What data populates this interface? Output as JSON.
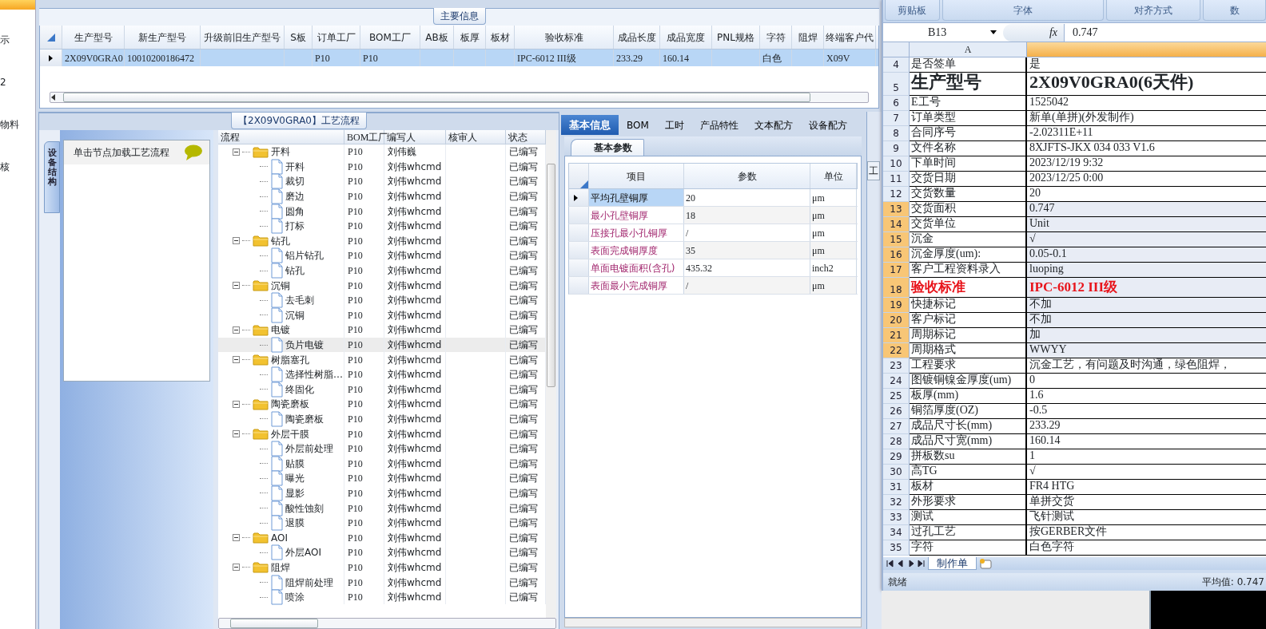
{
  "sidebar": {
    "items": [
      {
        "selected": true
      },
      {
        "label": "示",
        "selected": false
      },
      {
        "label": "2",
        "selected": false
      },
      {
        "label": "物料",
        "selected": false
      },
      {
        "label": "核",
        "selected": false
      }
    ]
  },
  "main_info": {
    "title": "主要信息",
    "columns": [
      "生产型号",
      "新生产型号",
      "升级前旧生产型号",
      "S板",
      "订单工厂",
      "BOM工厂",
      "AB板",
      "板厚",
      "板材",
      "验收标准",
      "成品长度",
      "成品宽度",
      "PNL规格",
      "字符",
      "阻焊",
      "终端客户代"
    ],
    "rows": [
      {
        "selected": true,
        "cells": [
          "2X09V0GRA0",
          "10010200186472",
          null,
          null,
          "P10",
          "P10",
          null,
          null,
          null,
          "IPC-6012 III级",
          "233.29",
          "160.14",
          null,
          "白色",
          null,
          "X09V"
        ]
      }
    ]
  },
  "process": {
    "title": "【2X09V0GRA0】工艺流程",
    "side_tab": "设备结构",
    "hint": "单击节点加载工艺流程",
    "columns": [
      "流程",
      "BOM工厂",
      "编写人",
      "核审人",
      "状态"
    ],
    "tree": [
      {
        "label": "开料",
        "bom": "P10",
        "author": "刘伟巍",
        "status": "已编写",
        "expanded": true,
        "selected": false,
        "children": [
          {
            "label": "开料",
            "bom": "P10",
            "author": "刘伟whcmd",
            "status": "已编写",
            "selected": false
          },
          {
            "label": "裁切",
            "bom": "P10",
            "author": "刘伟whcmd",
            "status": "已编写",
            "selected": false
          },
          {
            "label": "磨边",
            "bom": "P10",
            "author": "刘伟whcmd",
            "status": "已编写",
            "selected": false
          },
          {
            "label": "圆角",
            "bom": "P10",
            "author": "刘伟whcmd",
            "status": "已编写",
            "selected": false
          },
          {
            "label": "打标",
            "bom": "P10",
            "author": "刘伟whcmd",
            "status": "已编写",
            "selected": false
          }
        ]
      },
      {
        "label": "钻孔",
        "bom": "P10",
        "author": "刘伟whcmd",
        "status": "已编写",
        "expanded": true,
        "selected": false,
        "children": [
          {
            "label": "铝片钻孔",
            "bom": "P10",
            "author": "刘伟whcmd",
            "status": "已编写",
            "selected": false
          },
          {
            "label": "钻孔",
            "bom": "P10",
            "author": "刘伟whcmd",
            "status": "已编写",
            "selected": false
          }
        ]
      },
      {
        "label": "沉铜",
        "bom": "P10",
        "author": "刘伟whcmd",
        "status": "已编写",
        "expanded": true,
        "selected": false,
        "children": [
          {
            "label": "去毛刺",
            "bom": "P10",
            "author": "刘伟whcmd",
            "status": "已编写",
            "selected": false
          },
          {
            "label": "沉铜",
            "bom": "P10",
            "author": "刘伟whcmd",
            "status": "已编写",
            "selected": false
          }
        ]
      },
      {
        "label": "电镀",
        "bom": "P10",
        "author": "刘伟whcmd",
        "status": "已编写",
        "expanded": true,
        "selected": false,
        "children": [
          {
            "label": "负片电镀",
            "bom": "P10",
            "author": "刘伟whcmd",
            "status": "已编写",
            "selected": true
          }
        ]
      },
      {
        "label": "树脂塞孔",
        "bom": "P10",
        "author": "刘伟whcmd",
        "status": "已编写",
        "expanded": true,
        "selected": false,
        "children": [
          {
            "label": "选择性树脂…",
            "bom": "P10",
            "author": "刘伟whcmd",
            "status": "已编写",
            "selected": false
          },
          {
            "label": "终固化",
            "bom": "P10",
            "author": "刘伟whcmd",
            "status": "已编写",
            "selected": false
          }
        ]
      },
      {
        "label": "陶瓷磨板",
        "bom": "P10",
        "author": "刘伟whcmd",
        "status": "已编写",
        "expanded": true,
        "selected": false,
        "children": [
          {
            "label": "陶瓷磨板",
            "bom": "P10",
            "author": "刘伟whcmd",
            "status": "已编写",
            "selected": false
          }
        ]
      },
      {
        "label": "外层干膜",
        "bom": "P10",
        "author": "刘伟whcmd",
        "status": "已编写",
        "expanded": true,
        "selected": false,
        "children": [
          {
            "label": "外层前处理",
            "bom": "P10",
            "author": "刘伟whcmd",
            "status": "已编写",
            "selected": false
          },
          {
            "label": "贴膜",
            "bom": "P10",
            "author": "刘伟whcmd",
            "status": "已编写",
            "selected": false
          },
          {
            "label": "曝光",
            "bom": "P10",
            "author": "刘伟whcmd",
            "status": "已编写",
            "selected": false
          },
          {
            "label": "显影",
            "bom": "P10",
            "author": "刘伟whcmd",
            "status": "已编写",
            "selected": false
          },
          {
            "label": "酸性蚀刻",
            "bom": "P10",
            "author": "刘伟whcmd",
            "status": "已编写",
            "selected": false
          },
          {
            "label": "退膜",
            "bom": "P10",
            "author": "刘伟whcmd",
            "status": "已编写",
            "selected": false
          }
        ]
      },
      {
        "label": "AOI",
        "bom": "P10",
        "author": "刘伟whcmd",
        "status": "已编写",
        "expanded": true,
        "selected": false,
        "children": [
          {
            "label": "外层AOI",
            "bom": "P10",
            "author": "刘伟whcmd",
            "status": "已编写",
            "selected": false
          }
        ]
      },
      {
        "label": "阻焊",
        "bom": "P10",
        "author": "刘伟whcmd",
        "status": "已编写",
        "expanded": true,
        "selected": false,
        "children": [
          {
            "label": "阻焊前处理",
            "bom": "P10",
            "author": "刘伟whcmd",
            "status": "已编写",
            "selected": false
          },
          {
            "label": "喷涂",
            "bom": "P10",
            "author": "刘伟whcmd",
            "status": "已编写",
            "selected": false
          }
        ]
      }
    ]
  },
  "detail": {
    "tabs": [
      {
        "label": "基本信息",
        "selected": true
      },
      {
        "label": "BOM",
        "selected": false
      },
      {
        "label": "工时",
        "selected": false
      },
      {
        "label": "产品特性",
        "selected": false
      },
      {
        "label": "文本配方",
        "selected": false
      },
      {
        "label": "设备配方",
        "selected": false
      }
    ],
    "subtab": "基本参数",
    "columns": [
      "项目",
      "参数",
      "单位"
    ],
    "rows": [
      {
        "item": "平均孔壁铜厚",
        "value": "20",
        "unit": "μm",
        "selected": true
      },
      {
        "item": "最小孔壁铜厚",
        "value": "18",
        "unit": "μm",
        "selected": false
      },
      {
        "item": "压接孔最小孔铜厚",
        "value": "/",
        "unit": "μm",
        "selected": false
      },
      {
        "item": "表面完成铜厚度",
        "value": "35",
        "unit": "μm",
        "selected": false
      },
      {
        "item": "单面电镀面积(含孔)",
        "value": "435.32",
        "unit": "inch2",
        "selected": false
      },
      {
        "item": "表面最小完成铜厚",
        "value": "/",
        "unit": "μm",
        "selected": false
      }
    ]
  },
  "side_panel": {
    "label": "工"
  },
  "excel": {
    "ribbon_groups": [
      "剪贴板",
      "字体",
      "对齐方式",
      "数"
    ],
    "name_box": "B13",
    "function_symbol": "fx",
    "formula": "0.747",
    "column_a": "A",
    "rows": [
      {
        "n": "4",
        "a": "是否签单",
        "b": "是",
        "kind": "normal",
        "selected": false
      },
      {
        "n": "5",
        "a": "生产型号",
        "b": "2X09V0GRA0(6天件)",
        "kind": "title",
        "selected": false
      },
      {
        "n": "6",
        "a": "E工号",
        "b": "1525042",
        "kind": "normal",
        "selected": false
      },
      {
        "n": "7",
        "a": "订单类型",
        "b": "新单(单拼)(外发制作)",
        "kind": "normal",
        "selected": false
      },
      {
        "n": "8",
        "a": "合同序号",
        "b": "-2.02311E+11",
        "kind": "normal",
        "selected": false
      },
      {
        "n": "9",
        "a": "文件名称",
        "b": "8XJFTS-JKX 034 033 V1.6",
        "kind": "normal",
        "selected": false
      },
      {
        "n": "10",
        "a": "下单时间",
        "b": "2023/12/19 9:32",
        "kind": "normal",
        "selected": false
      },
      {
        "n": "11",
        "a": "交货日期",
        "b": "2023/12/25 0:00",
        "kind": "normal",
        "selected": false
      },
      {
        "n": "12",
        "a": "交货数量",
        "b": "20",
        "kind": "normal",
        "selected": false
      },
      {
        "n": "13",
        "a": "交货面积",
        "b": "0.747",
        "kind": "normal",
        "selected": true
      },
      {
        "n": "14",
        "a": "交货单位",
        "b": "Unit",
        "kind": "normal",
        "selected": true
      },
      {
        "n": "15",
        "a": "沉金",
        "b": "√",
        "kind": "normal",
        "selected": true
      },
      {
        "n": "16",
        "a": "沉金厚度(um):",
        "b": "0.05-0.1",
        "kind": "normal",
        "selected": true
      },
      {
        "n": "17",
        "a": "客户工程资料录入",
        "b": "luoping",
        "kind": "normal",
        "selected": true
      },
      {
        "n": "18",
        "a": "验收标准",
        "b": "IPC-6012 III级",
        "kind": "alert",
        "selected": true
      },
      {
        "n": "19",
        "a": "快捷标记",
        "b": "不加",
        "kind": "normal",
        "selected": true
      },
      {
        "n": "20",
        "a": "客户标记",
        "b": "不加",
        "kind": "normal",
        "selected": true
      },
      {
        "n": "21",
        "a": "周期标记",
        "b": "加",
        "kind": "normal",
        "selected": true
      },
      {
        "n": "22",
        "a": "周期格式",
        "b": "WWYY",
        "kind": "normal",
        "selected": true
      },
      {
        "n": "23",
        "a": "工程要求",
        "b": "沉金工艺，有问题及时沟通，绿色阻焊，",
        "kind": "normal",
        "selected": false
      },
      {
        "n": "24",
        "a": "图镀铜镍金厚度(um)",
        "b": "0",
        "kind": "normal",
        "selected": false
      },
      {
        "n": "25",
        "a": "板厚(mm)",
        "b": "1.6",
        "kind": "normal",
        "selected": false
      },
      {
        "n": "26",
        "a": "铜箔厚度(OZ)",
        "b": "-0.5",
        "kind": "normal",
        "selected": false
      },
      {
        "n": "27",
        "a": "成品尺寸长(mm)",
        "b": "233.29",
        "kind": "normal",
        "selected": false
      },
      {
        "n": "28",
        "a": "成品尺寸宽(mm)",
        "b": "160.14",
        "kind": "normal",
        "selected": false
      },
      {
        "n": "29",
        "a": "拼板数su",
        "b": "1",
        "kind": "normal",
        "selected": false
      },
      {
        "n": "30",
        "a": "高TG",
        "b": "√",
        "kind": "normal",
        "selected": false
      },
      {
        "n": "31",
        "a": "板材",
        "b": "FR4 HTG",
        "kind": "normal",
        "selected": false
      },
      {
        "n": "32",
        "a": "外形要求",
        "b": "单拼交货",
        "kind": "normal",
        "selected": false
      },
      {
        "n": "33",
        "a": "测试",
        "b": "飞针测试",
        "kind": "normal",
        "selected": false
      },
      {
        "n": "34",
        "a": "过孔工艺",
        "b": "按GERBER文件",
        "kind": "normal",
        "selected": false
      },
      {
        "n": "35",
        "a": "字符",
        "b": "白色字符",
        "kind": "normal",
        "selected": false
      }
    ],
    "sheet_tabs": [
      {
        "label": "制作单",
        "selected": true
      }
    ],
    "status": "就绪",
    "summary": "平均值: 0.747"
  }
}
